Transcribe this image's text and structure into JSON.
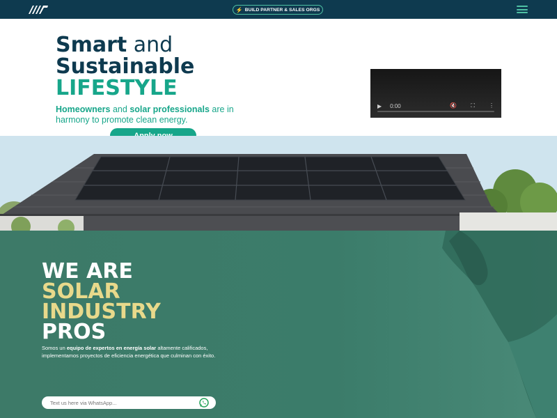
{
  "header": {
    "pill_label": "BUILD PARTNER & SALES ORGS",
    "menu_icon": "hamburger-menu-icon",
    "logo_icon": "brand-logo-icon"
  },
  "hero": {
    "title_line1_bold": "Smart",
    "title_line1_light": " and",
    "title_line2": "Sustainable",
    "title_line3": "LIFESTYLE",
    "sub_part1": "Homeowners",
    "sub_part2": " and ",
    "sub_part3": "solar professionals",
    "sub_part4": " are in harmony to promote clean energy.",
    "apply_label": "Apply now"
  },
  "video": {
    "time": "0:00",
    "play_icon": "play-icon",
    "mute_icon": "muted-speaker-icon",
    "fullscreen_icon": "fullscreen-icon",
    "more_icon": "more-options-icon"
  },
  "about": {
    "line1": "WE ARE",
    "line2": "SOLAR",
    "line3": "INDUSTRY",
    "line4": "PROS",
    "desc_part1": "Somos un ",
    "desc_part2": "equipo de expertos en energía solar",
    "desc_part3": " altamente calificados, implementamos proyectos de eficiencia energética que culminan con éxito."
  },
  "whatsapp": {
    "placeholder": "Text us here via WhatsApp...",
    "icon": "whatsapp-icon"
  },
  "colors": {
    "navy": "#0e3a4f",
    "teal": "#17a68a",
    "green_bg": "#3d7a68",
    "gold": "#e8d98b"
  }
}
